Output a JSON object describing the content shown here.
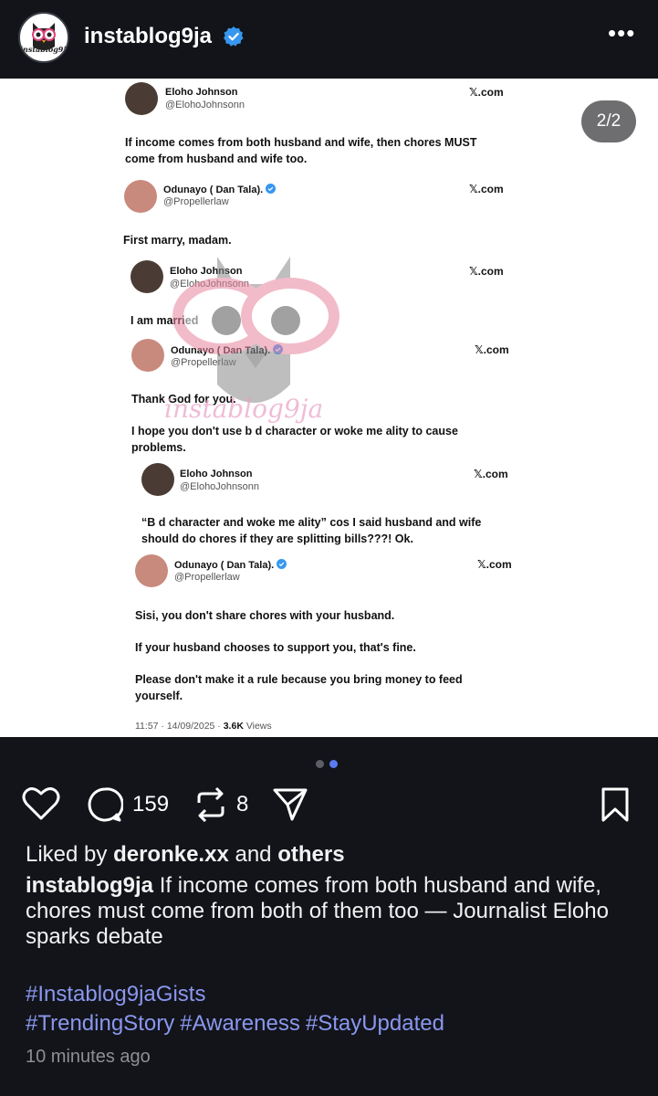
{
  "header": {
    "username": "instablog9ja",
    "avatar_text": "instablog9ja",
    "more_label": "•••"
  },
  "post": {
    "counter": "2/2",
    "watermark_text": "instablog9ja",
    "tweets": [
      {
        "name": "Eloho Johnson",
        "handle": "@ElohoJohnsonn",
        "source": "𝕏.com",
        "verified": false,
        "body": "If income comes from both husband and wife, then chores MUST come from husband and wife too."
      },
      {
        "name": "Odunayo ( Dan Tala).",
        "handle": "@Propellerlaw",
        "source": "𝕏.com",
        "verified": true,
        "body": "First marry, madam."
      },
      {
        "name": "Eloho Johnson",
        "handle": "@ElohoJohnsonn",
        "source": "𝕏.com",
        "verified": false,
        "body": "I am married"
      },
      {
        "name": "Odunayo ( Dan Tala).",
        "handle": "@Propellerlaw",
        "source": "𝕏.com",
        "verified": true,
        "body": "Thank God for you.",
        "body2": "I hope you don't use b d character or woke me ality to cause problems."
      },
      {
        "name": "Eloho Johnson",
        "handle": "@ElohoJohnsonn",
        "source": "𝕏.com",
        "verified": false,
        "body": "“B d character and woke me ality” cos I said husband and wife should do chores if they are splitting bills???! Ok."
      },
      {
        "name": "Odunayo ( Dan Tala).",
        "handle": "@Propellerlaw",
        "source": "𝕏.com",
        "verified": true,
        "body": "Sisi, you don't share chores with your husband.",
        "body2": "If your husband chooses to support you, that's fine.",
        "body3": "Please don't make it a rule because you bring money to feed yourself."
      }
    ],
    "meta_time": "11:57 · 14/09/2025 · ",
    "meta_views": "3.6K",
    "meta_views_label": " Views"
  },
  "actions": {
    "comments": "159",
    "reposts": "8"
  },
  "likes": {
    "prefix": "Liked by ",
    "user": "deronke.xx",
    "middle": " and ",
    "others": "others"
  },
  "caption": {
    "user": "instablog9ja",
    "text": " If income comes from both husband and wife, chores must come from both of them too — Journalist Eloho sparks debate"
  },
  "hashtags": [
    "#Instablog9jaGists",
    "#TrendingStory",
    "#Awareness",
    "#StayUpdated"
  ],
  "time_ago": "10 minutes ago",
  "colors": {
    "background": "#12141a",
    "verified": "#3797f0",
    "hashtag": "#8a97ee",
    "dot_active": "#5a7cf0",
    "dot_inactive": "#5c5e66"
  }
}
